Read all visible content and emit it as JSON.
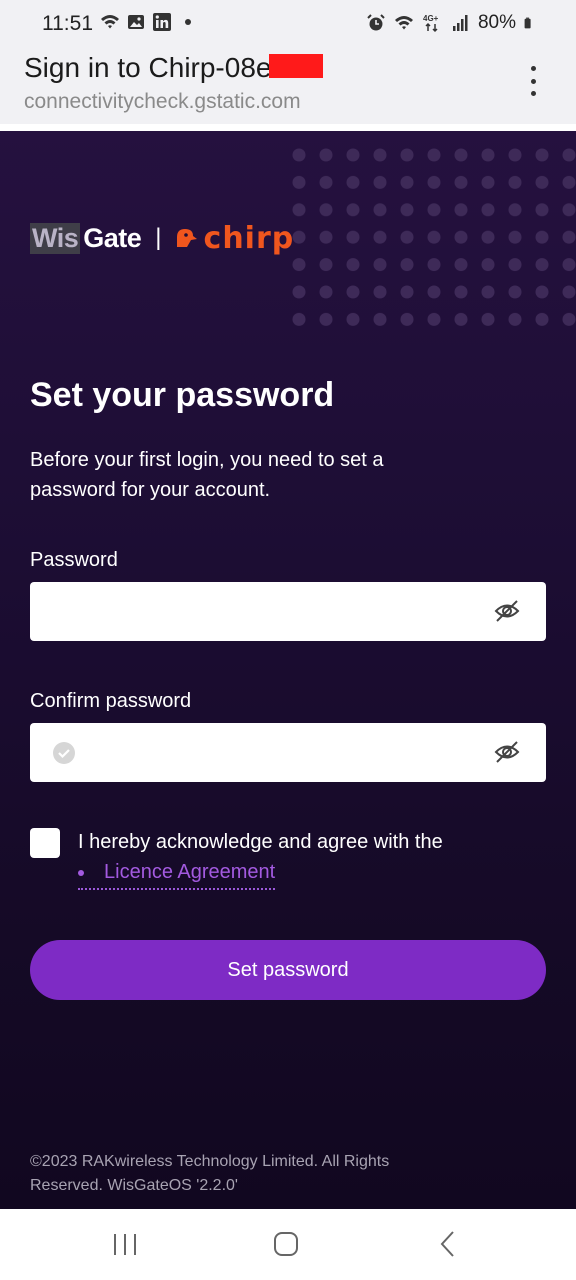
{
  "status_bar": {
    "time": "11:51",
    "battery": "80%",
    "left_icons": [
      "wifi-icon",
      "image-icon",
      "linkedin-icon",
      "dot-icon"
    ],
    "right_icons": [
      "alarm-icon",
      "wifi-icon",
      "4g-icon",
      "signal-icon",
      "battery-icon"
    ]
  },
  "browser": {
    "title": "Sign in to Chirp-08e",
    "url": "connectivitycheck.gstatic.com",
    "menu_icon": "more-vert-icon"
  },
  "logo": {
    "wis": "Wis",
    "gate": "Gate",
    "separator": "|",
    "chirp": "chirp",
    "chirp_color": "#f0561e"
  },
  "form": {
    "heading": "Set your password",
    "subtitle": "Before your first login, you need to set a password for your account.",
    "password_label": "Password",
    "password_value": "",
    "confirm_label": "Confirm password",
    "confirm_value": "",
    "acknowledge_text": "I hereby acknowledge and agree with the",
    "licence_link": "Licence Agreement",
    "checkbox_checked": false,
    "submit_label": "Set password"
  },
  "colors": {
    "accent": "#7e2bc5",
    "link": "#a35ae0",
    "background_top": "#25113f",
    "background_bottom": "#110720"
  },
  "footer": {
    "copyright": "©2023 RAKwireless Technology Limited. All Rights Reserved. WisGateOS '2.2.0'"
  },
  "nav_bar": {
    "buttons": [
      "recents-icon",
      "home-icon",
      "back-icon"
    ]
  }
}
